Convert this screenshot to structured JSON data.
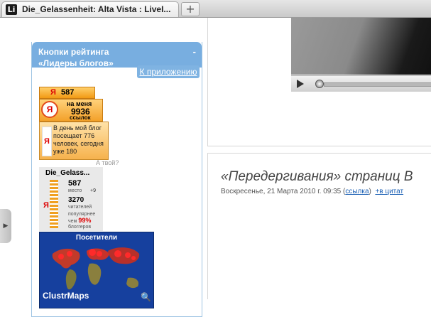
{
  "browser": {
    "tab_icon": "Li",
    "tab_title": "Die_Gelassenheit: Alta Vista : LiveI...",
    "new_tab": "+"
  },
  "sidebar": {
    "title_line1": "Кнопки рейтинга",
    "title_line2": "«Лидеры блогов»",
    "collapse": "-",
    "app_link": "К приложению"
  },
  "badges": {
    "rank_ya": "Я",
    "rank_value": "587",
    "ref_ya": "Я",
    "ref_label_top": "на меня",
    "ref_value": "9936",
    "ref_label_bottom": "ссылок",
    "day_ya": "Я",
    "day_text": "В день мой блог посещает 776 человек, сегодня уже 180",
    "atvoy": "А твой?",
    "stat_name": "Die_Gelass...",
    "stat_ya": "Я",
    "stat_place_value": "587",
    "stat_place_label": "место",
    "stat_delta": "+9",
    "stat_readers_value": "3270",
    "stat_readers_label": "читателей",
    "stat_popular_label": "популярнее чем",
    "stat_popular_pct": "99%",
    "stat_bloggers": "блоггеров",
    "map_header": "Посетители",
    "map_logo": "ClustrMaps",
    "map_zoom": "🔍"
  },
  "post": {
    "title": "«Передергивания» страниц В",
    "date": "Воскресенье, 21 Марта 2010 г. 09:35 (",
    "link": "ссылка",
    "close": ")",
    "quote": "+в цитат"
  },
  "colors": {
    "accent": "#78aee0",
    "badge_orange": "#f29a14"
  }
}
